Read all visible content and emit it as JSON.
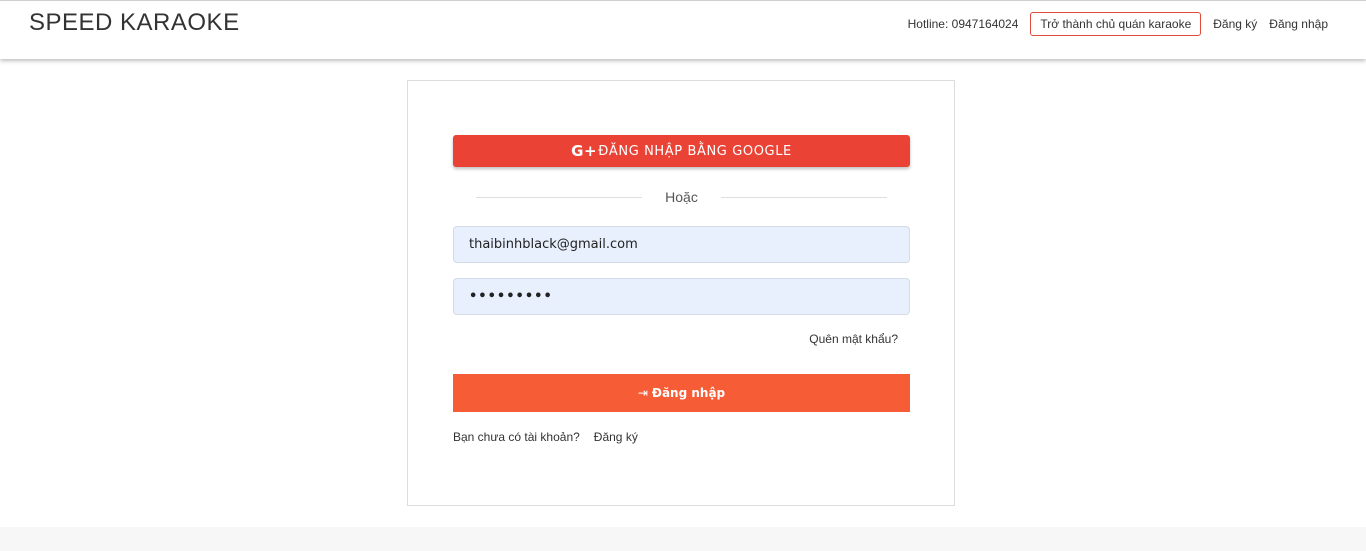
{
  "header": {
    "brand": "SPEED KARAOKE",
    "hotline": "Hotline: 0947164024",
    "owner_button": "Trở thành chủ quán karaoke",
    "register_link": "Đăng ký",
    "login_link": "Đăng nhập"
  },
  "login_card": {
    "google_icon": "G+",
    "google_button": "ĐĂNG NHẬP BẰNG GOOGLE",
    "divider_text": "Hoặc",
    "email_value": "thaibinhblack@gmail.com",
    "password_value": "•••••••••",
    "forgot_link": "Quên mật khẩu?",
    "login_icon": "⇥",
    "login_button": "Đăng nhập",
    "no_account_text": "Bạn chưa có tài khoản?",
    "signup_link": "Đăng ký"
  },
  "colors": {
    "google_red": "#ea4335",
    "login_orange": "#f65d37",
    "input_bg": "#e8f0fe"
  }
}
